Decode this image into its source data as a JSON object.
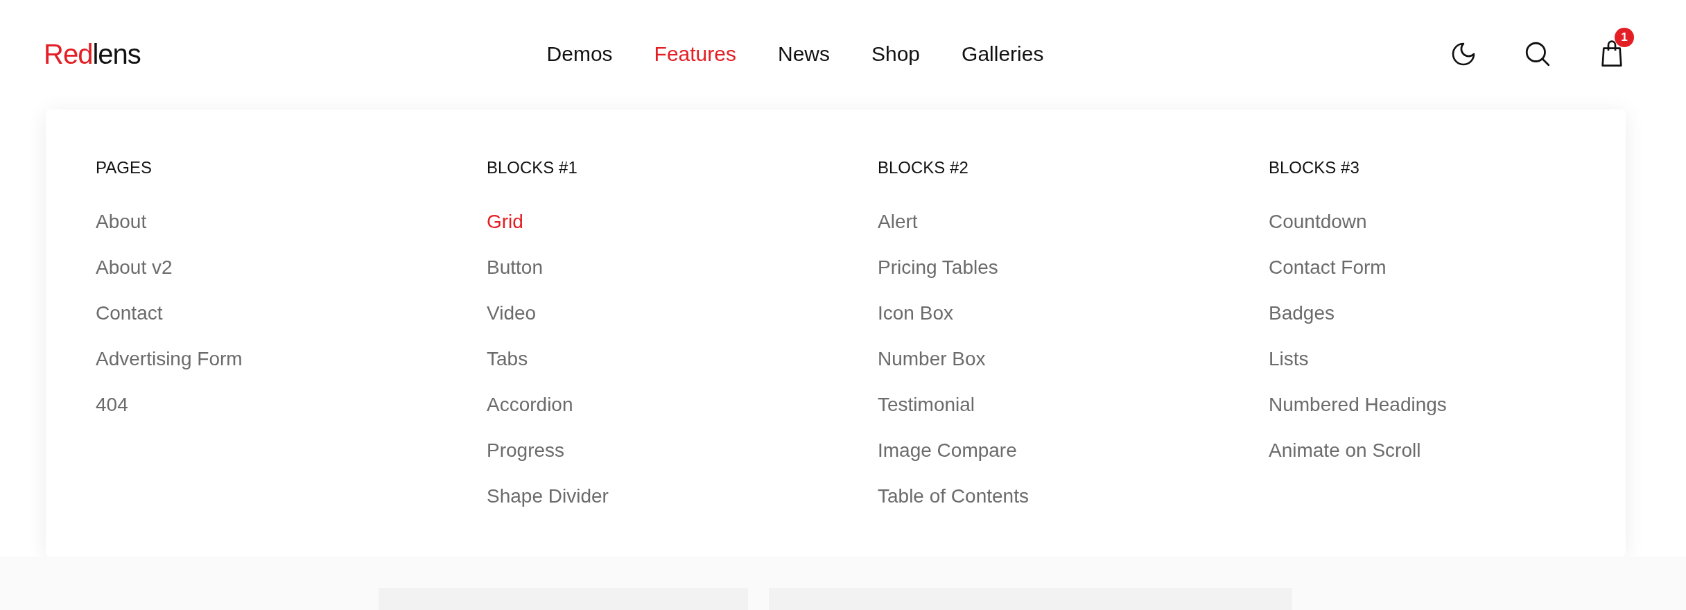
{
  "logo": {
    "accent": "Red",
    "rest": "lens"
  },
  "nav": [
    {
      "label": "Demos",
      "selected": false
    },
    {
      "label": "Features",
      "selected": true
    },
    {
      "label": "News",
      "selected": false
    },
    {
      "label": "Shop",
      "selected": false
    },
    {
      "label": "Galleries",
      "selected": false
    }
  ],
  "cart": {
    "count": "1"
  },
  "menu": [
    {
      "heading": "PAGES",
      "items": [
        {
          "label": "About",
          "selected": false
        },
        {
          "label": "About v2",
          "selected": false
        },
        {
          "label": "Contact",
          "selected": false
        },
        {
          "label": "Advertising Form",
          "selected": false
        },
        {
          "label": "404",
          "selected": false
        }
      ]
    },
    {
      "heading": "BLOCKS #1",
      "items": [
        {
          "label": "Grid",
          "selected": true
        },
        {
          "label": "Button",
          "selected": false
        },
        {
          "label": "Video",
          "selected": false
        },
        {
          "label": "Tabs",
          "selected": false
        },
        {
          "label": "Accordion",
          "selected": false
        },
        {
          "label": "Progress",
          "selected": false
        },
        {
          "label": "Shape Divider",
          "selected": false
        }
      ]
    },
    {
      "heading": "BLOCKS #2",
      "items": [
        {
          "label": "Alert",
          "selected": false
        },
        {
          "label": "Pricing Tables",
          "selected": false
        },
        {
          "label": "Icon Box",
          "selected": false
        },
        {
          "label": "Number Box",
          "selected": false
        },
        {
          "label": "Testimonial",
          "selected": false
        },
        {
          "label": "Image Compare",
          "selected": false
        },
        {
          "label": "Table of Contents",
          "selected": false
        }
      ]
    },
    {
      "heading": "BLOCKS #3",
      "items": [
        {
          "label": "Countdown",
          "selected": false
        },
        {
          "label": "Contact Form",
          "selected": false
        },
        {
          "label": "Badges",
          "selected": false
        },
        {
          "label": "Lists",
          "selected": false
        },
        {
          "label": "Numbered Headings",
          "selected": false
        },
        {
          "label": "Animate on Scroll",
          "selected": false
        }
      ]
    }
  ]
}
